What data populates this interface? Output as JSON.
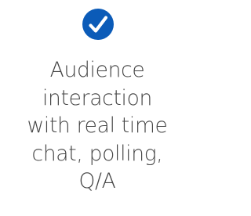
{
  "icon": "check-circle-icon",
  "accent_color": "#0B5BB8",
  "feature": {
    "lines": [
      "Audience",
      "interaction",
      "with real time",
      "chat, polling,",
      "Q/A"
    ]
  }
}
